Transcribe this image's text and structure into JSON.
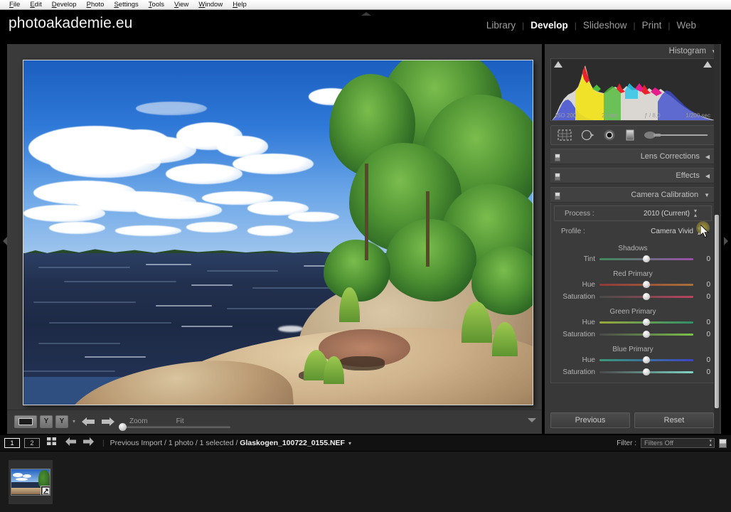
{
  "menubar": {
    "items": [
      "File",
      "Edit",
      "Develop",
      "Photo",
      "Settings",
      "Tools",
      "View",
      "Window",
      "Help"
    ]
  },
  "identity_plate": "photoakademie.eu",
  "modules": [
    {
      "label": "Library",
      "active": false
    },
    {
      "label": "Develop",
      "active": true
    },
    {
      "label": "Slideshow",
      "active": false
    },
    {
      "label": "Print",
      "active": false
    },
    {
      "label": "Web",
      "active": false
    }
  ],
  "module_separator": "|",
  "right_panel": {
    "histogram": {
      "title": "Histogram",
      "arrow": "▼",
      "exif": {
        "iso": "ISO 200",
        "focal": "28 mm",
        "aperture": "ƒ / 8,0",
        "shutter": "1/200 sec"
      }
    },
    "tools": [
      {
        "name": "crop-overlay-tool"
      },
      {
        "name": "spot-removal-tool"
      },
      {
        "name": "red-eye-correction-tool"
      },
      {
        "name": "graduated-filter-tool"
      },
      {
        "name": "adjustment-brush-tool"
      }
    ],
    "panels": [
      {
        "title": "Lens Corrections",
        "arrow": "◀",
        "expanded": false
      },
      {
        "title": "Effects",
        "arrow": "◀",
        "expanded": false
      },
      {
        "title": "Camera Calibration",
        "arrow": "▼",
        "expanded": true
      }
    ],
    "camera_calibration": {
      "process": {
        "label": "Process :",
        "value": "2010 (Current)"
      },
      "profile": {
        "label": "Profile :",
        "value": "Camera Vivid"
      },
      "groups": [
        {
          "title": "Shadows",
          "sliders": [
            {
              "label": "Tint",
              "value": "0",
              "track_from": "#3e8a5a",
              "track_to": "#9a4fa8"
            }
          ]
        },
        {
          "title": "Red Primary",
          "sliders": [
            {
              "label": "Hue",
              "value": "0",
              "track_from": "#8d3a3a",
              "track_to": "#a8703a"
            },
            {
              "label": "Saturation",
              "value": "0",
              "track_from": "#4a4a4a",
              "track_to": "#b8455c"
            }
          ]
        },
        {
          "title": "Green Primary",
          "sliders": [
            {
              "label": "Hue",
              "value": "0",
              "track_from": "#9aa83a",
              "track_to": "#2f8f6a"
            },
            {
              "label": "Saturation",
              "value": "0",
              "track_from": "#4a4a4a",
              "track_to": "#7cc24a"
            }
          ]
        },
        {
          "title": "Blue Primary",
          "sliders": [
            {
              "label": "Hue",
              "value": "0",
              "track_from": "#3a9a78",
              "track_to": "#3d45c8"
            },
            {
              "label": "Saturation",
              "value": "0",
              "track_from": "#4a4a4a",
              "track_to": "#7fd4c6"
            }
          ]
        }
      ]
    },
    "buttons": {
      "previous": "Previous",
      "reset": "Reset"
    }
  },
  "toolbar": {
    "view_loupe": "loupe-view",
    "compare": "YY",
    "caret": "▾",
    "back": "←",
    "forward": "→",
    "zoom_label": "Zoom",
    "zoom_value": "Fit",
    "right_caret": "▼"
  },
  "filmstrip_bar": {
    "screen_buttons": [
      {
        "label": "1",
        "active": true
      },
      {
        "label": "2",
        "active": false
      }
    ],
    "grid_icon": "grid-view-icon",
    "back_arrow": "←",
    "forward_arrow": "→",
    "breadcrumb_prefix": "Previous Import / 1 photo / 1 selected / ",
    "filename": "Glaskogen_100722_0155.NEF",
    "filename_caret": "▾",
    "filter_label": "Filter :",
    "filter_value": "Filters Off"
  },
  "panel_triangles": {
    "top": "▲",
    "bottom": "▼",
    "left": "◀",
    "right": "▶"
  },
  "colors": {
    "panel_bg": "#383838",
    "canvas_bg": "#3a3a3a",
    "accent_text": "#ffffff",
    "muted_text": "#9b9b9b",
    "hover_highlight": "#ada040"
  },
  "photo": {
    "description": "Lake Glaskogen shoreline with blue sky, cumulus clouds, pine trees and granite rocks"
  }
}
